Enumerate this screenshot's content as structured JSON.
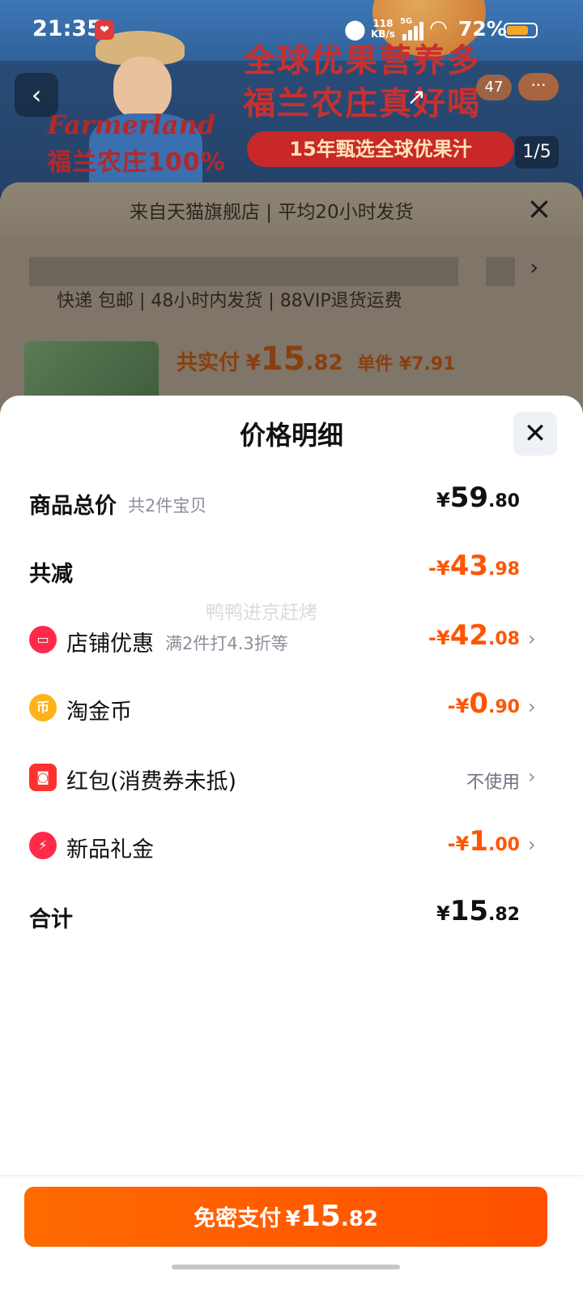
{
  "status_bar": {
    "time": "21:35",
    "network_speed": "118\nKB/s",
    "network_type": "5G",
    "battery_percent": "72%"
  },
  "background_page": {
    "hero": {
      "brand_script": "Farmerland",
      "brand_cn": "福兰农庄100%",
      "slogan_line1": "全球优果营养多",
      "slogan_line2": "福兰农庄真好喝",
      "badge": "15年甄选全球优果汁",
      "image_counter": "1/5",
      "cart_count": "47"
    },
    "notice": "来自天猫旗舰店 | 平均20小时发货",
    "service_tags": "快递 包邮 | 48小时内发货 | 88VIP退货运费",
    "product": {
      "paid_prefix": "共实付",
      "paid_currency": "¥",
      "paid_int": "15",
      "paid_dec": ".82",
      "unit_price": "单件 ¥7.91"
    }
  },
  "sheet": {
    "title": "价格明细",
    "rows": [
      {
        "label": "商品总价",
        "sub": "共2件宝贝",
        "currency": "¥",
        "int": "59",
        "dec": ".80"
      },
      {
        "label": "共减",
        "currency": "-¥",
        "int": "43",
        "dec": ".98"
      },
      {
        "label": "店铺优惠",
        "sub": "满2件打4.3折等",
        "currency": "-¥",
        "int": "42",
        "dec": ".08",
        "icon": "store-coupon-icon"
      },
      {
        "label": "淘金币",
        "currency": "-¥",
        "int": "0",
        "dec": ".90",
        "icon": "coin-icon",
        "icon_glyph": "币"
      },
      {
        "label": "红包(消费券未抵)",
        "value": "不使用",
        "icon": "red-packet-icon"
      },
      {
        "label": "新品礼金",
        "currency": "-¥",
        "int": "1",
        "dec": ".00",
        "icon": "lightning-icon"
      },
      {
        "label": "合计",
        "currency": "¥",
        "int": "15",
        "dec": ".82"
      }
    ],
    "watermark": "鸭鸭进京赶烤"
  },
  "pay_button": {
    "label": "免密支付",
    "currency": "¥",
    "int": "15",
    "dec": ".82"
  },
  "colors": {
    "accent_orange": "#ff5500",
    "pay_button": "#ff5a00",
    "text_primary": "#111111",
    "text_secondary": "#8a8f99"
  }
}
